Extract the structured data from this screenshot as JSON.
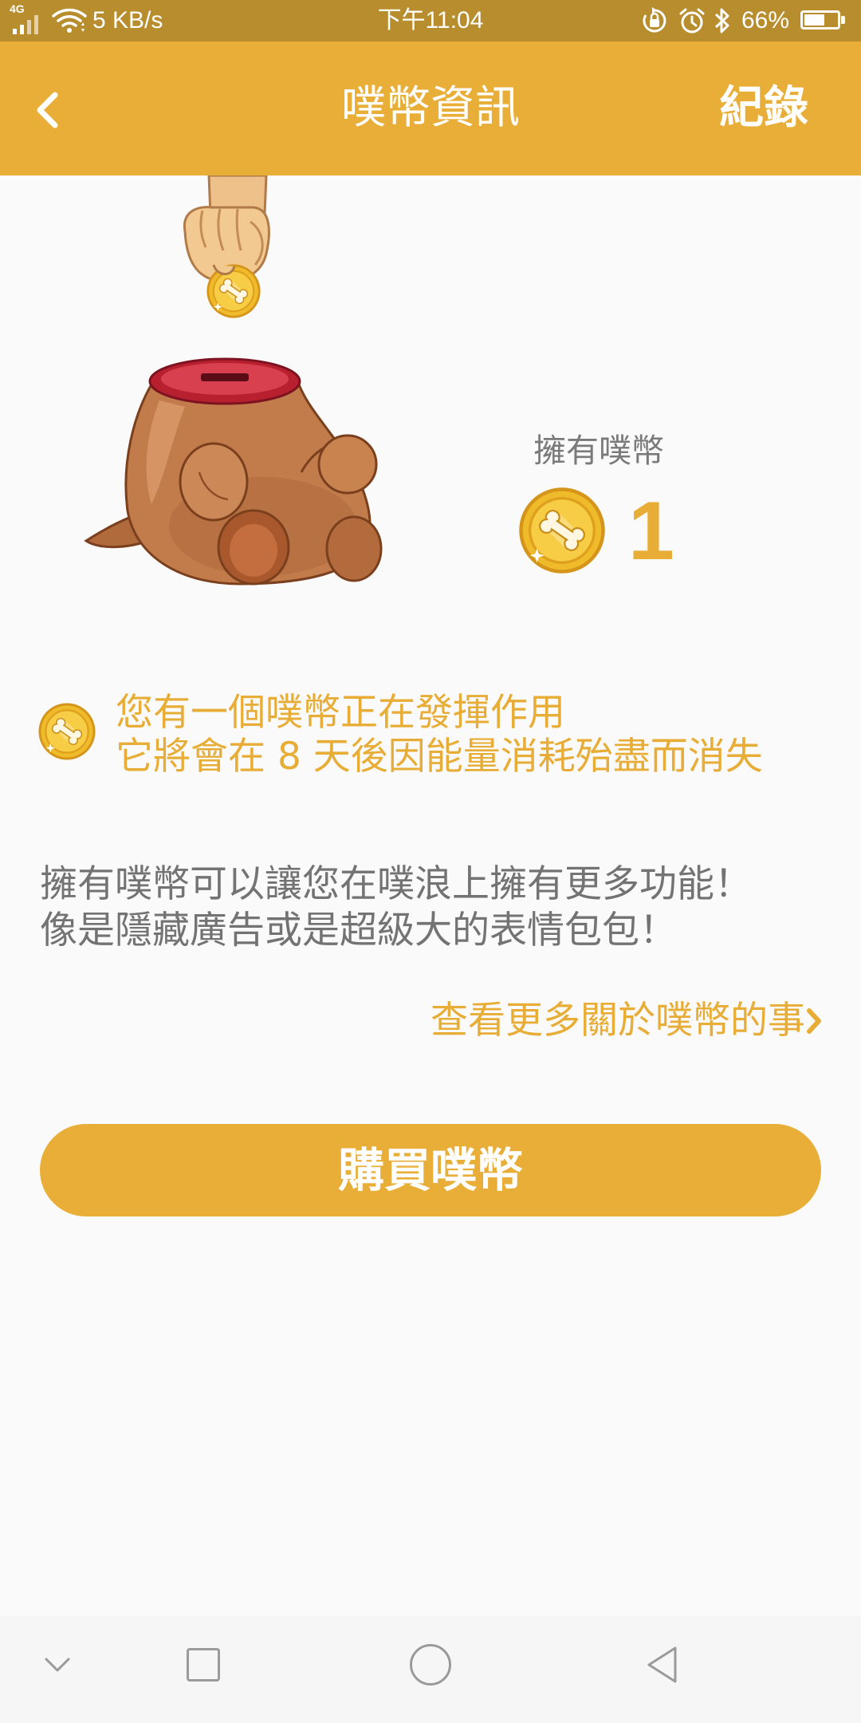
{
  "status_bar": {
    "network_type": "4G",
    "speed": "5 KB/s",
    "time": "下午11:04",
    "battery_percent": "66%",
    "battery_level": 0.66,
    "icons": [
      "signal-icon",
      "wifi-icon",
      "rotation-lock-icon",
      "alarm-icon",
      "bluetooth-icon",
      "battery-icon"
    ]
  },
  "header": {
    "title": "噗幣資訊",
    "record_label": "紀錄",
    "back_icon": "chevron-left-icon"
  },
  "balance": {
    "label": "擁有噗幣",
    "count": 1,
    "icon": "coin-icon"
  },
  "active_notice": {
    "icon": "coin-icon",
    "line1": "您有一個噗幣正在發揮作用",
    "line2": "它將會在 8 天後因能量消耗殆盡而消失"
  },
  "description": {
    "line1": "擁有噗幣可以讓您在噗浪上擁有更多功能！",
    "line2": "像是隱藏廣告或是超級大的表情包包！"
  },
  "more_link": {
    "label": "查看更多關於噗幣的事",
    "icon": "chevron-right-icon"
  },
  "buy_button": {
    "label": "購買噗幣"
  },
  "nav_bar": {
    "icons": [
      "chevron-down-icon",
      "recents-square-icon",
      "home-circle-icon",
      "back-triangle-icon"
    ]
  },
  "colors": {
    "status_bar": "#b78d2e",
    "header": "#e9ae37",
    "accent": "#e8ad36",
    "body_text": "#737373",
    "background": "#fafafa"
  }
}
